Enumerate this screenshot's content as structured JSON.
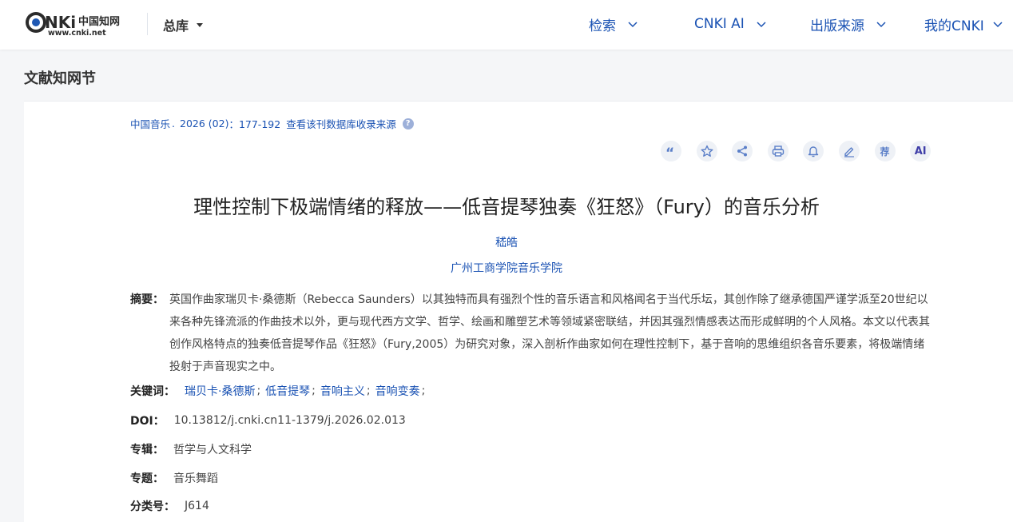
{
  "header": {
    "logo_alt": "CNKI中国知网 www.cnki.net",
    "library_label": "总库",
    "nav": [
      {
        "label": "检索"
      },
      {
        "label": "CNKI AI"
      },
      {
        "label": "出版来源"
      },
      {
        "label": "我的CNKI"
      }
    ]
  },
  "section_title": "文献知网节",
  "source": {
    "journal": "中国音乐",
    "separator": ".",
    "issue": "2026 (02)",
    "pages": "：177-192",
    "db_link": "查看该刊数据库收录来源"
  },
  "toolbar": {
    "icons": [
      "quote-icon",
      "star-icon",
      "share-icon",
      "print-icon",
      "bell-icon",
      "edit-icon",
      "recommend-icon",
      "ai-icon"
    ],
    "recommend_label": "荐",
    "ai_label": "AI"
  },
  "article": {
    "title": "理性控制下极端情绪的释放——低音提琴独奏《狂怒》（Fury）的音乐分析",
    "author": "嵇皓",
    "affiliation": "广州工商学院音乐学院",
    "abstract_label": "摘要：",
    "abstract": "英国作曲家瑞贝卡·桑德斯（Rebecca Saunders）以其独特而具有强烈个性的音乐语言和风格闻名于当代乐坛，其创作除了继承德国严谨学派至20世纪以来各种先锋流派的作曲技术以外，更与现代西方文学、哲学、绘画和雕塑艺术等领域紧密联结，并因其强烈情感表达而形成鲜明的个人风格。本文以代表其创作风格特点的独奏低音提琴作品《狂怒》（Fury,2005）为研究对象，深入剖析作曲家如何在理性控制下，基于音响的思维组织各音乐要素，将极端情绪投射于声音现实之中。",
    "keywords_label": "关键词：",
    "keywords": [
      "瑞贝卡·桑德斯",
      "低音提琴",
      "音响主义",
      "音响变奏"
    ],
    "keyword_sep": ";",
    "doi_label": "DOI：",
    "doi": "10.13812/j.cnki.cn11-1379/j.2026.02.013",
    "album_label": "专辑：",
    "album": "哲学与人文科学",
    "topic_label": "专题：",
    "topic": "音乐舞蹈",
    "class_label": "分类号：",
    "class_code": "J614"
  },
  "colors": {
    "link": "#1a52b3",
    "tool_bg": "#eef1f6",
    "page_bg": "#f5f6f8"
  }
}
